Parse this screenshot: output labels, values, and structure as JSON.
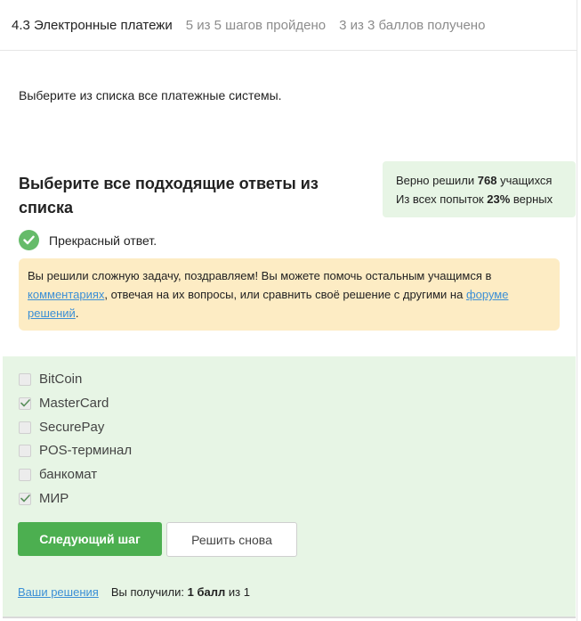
{
  "header": {
    "title": "4.3 Электронные платежи",
    "steps": "5 из 5 шагов пройдено",
    "points": "3 из 3 баллов  получено"
  },
  "prompt": "Выберите из списка все платежные системы.",
  "question": {
    "title": "Выберите все подходящие ответы из списка"
  },
  "stats": {
    "line1_prefix": "Верно решили",
    "solved_count": "768",
    "line1_suffix": "учащихся",
    "line2_prefix": "Из всех попыток",
    "percent": "23%",
    "line2_suffix": "верных"
  },
  "result": {
    "text": "Прекрасный ответ.",
    "icon": "check-circle-icon",
    "color": "#66bb6a"
  },
  "notice": {
    "part1": "Вы решили сложную задачу, поздравляем! Вы можете помочь остальным учащимся в ",
    "link_comments": "комментариях",
    "part2": ", отвечая на их вопросы, или сравнить своё решение с другими на ",
    "link_forum": "форуме решений",
    "part3": "."
  },
  "options": [
    {
      "label": "BitCoin",
      "checked": false
    },
    {
      "label": "MasterCard",
      "checked": true
    },
    {
      "label": "SecurePay",
      "checked": false
    },
    {
      "label": "POS-терминал",
      "checked": false
    },
    {
      "label": "банкомат",
      "checked": false
    },
    {
      "label": "МИР",
      "checked": true
    }
  ],
  "buttons": {
    "next": "Следующий шаг",
    "retry": "Решить снова"
  },
  "footer": {
    "solutions_link": "Ваши решения",
    "received_prefix": "Вы получили:",
    "received_value": "1 балл",
    "received_suffix": "из 1"
  },
  "colors": {
    "accent_green": "#4caf50",
    "success_bg": "#e7f5e5",
    "notice_bg": "#fdecc4",
    "link": "#3b8fd6"
  }
}
